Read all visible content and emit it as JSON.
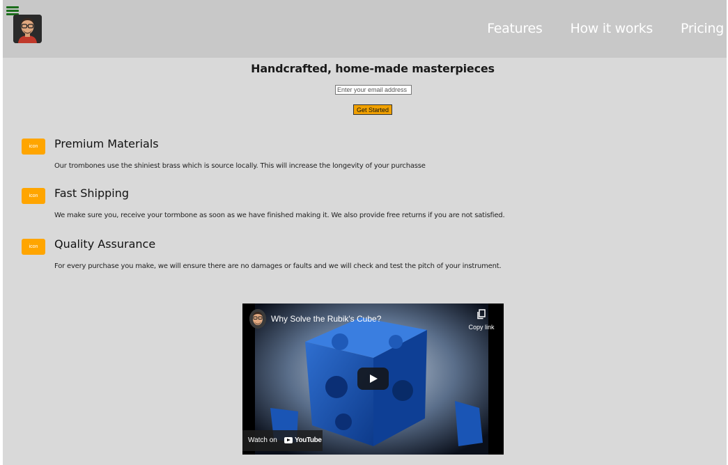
{
  "nav": {
    "links": [
      "Features",
      "How it works",
      "Pricing"
    ]
  },
  "hero": {
    "title": "Handcrafted, home-made masterpieces",
    "email_placeholder": "Enter your email address",
    "cta_label": "Get Started"
  },
  "features": [
    {
      "icon_label": "icon",
      "title": "Premium Materials",
      "description": "Our trombones use the shiniest brass which is source locally. This will increase the longevity of your purchasse"
    },
    {
      "icon_label": "icon",
      "title": "Fast Shipping",
      "description": "We make sure you, receive your tormbone as soon as we have finished making it. We also provide free returns if you are not satisfied."
    },
    {
      "icon_label": "icon",
      "title": "Quality Assurance",
      "description": "For every purchase you make, we will ensure there are no damages or faults and we will check and test the pitch of your instrument."
    }
  ],
  "video": {
    "title": "Why Solve the Rubik's Cube?",
    "copy_link_label": "Copy link",
    "watch_on_label": "Watch on",
    "youtube_label": "YouTube"
  },
  "colors": {
    "header_bg": "#c8c8c8",
    "page_bg": "#d9d9d9",
    "accent_orange": "#ffa500",
    "hamburger_green": "#1b6e1b"
  }
}
